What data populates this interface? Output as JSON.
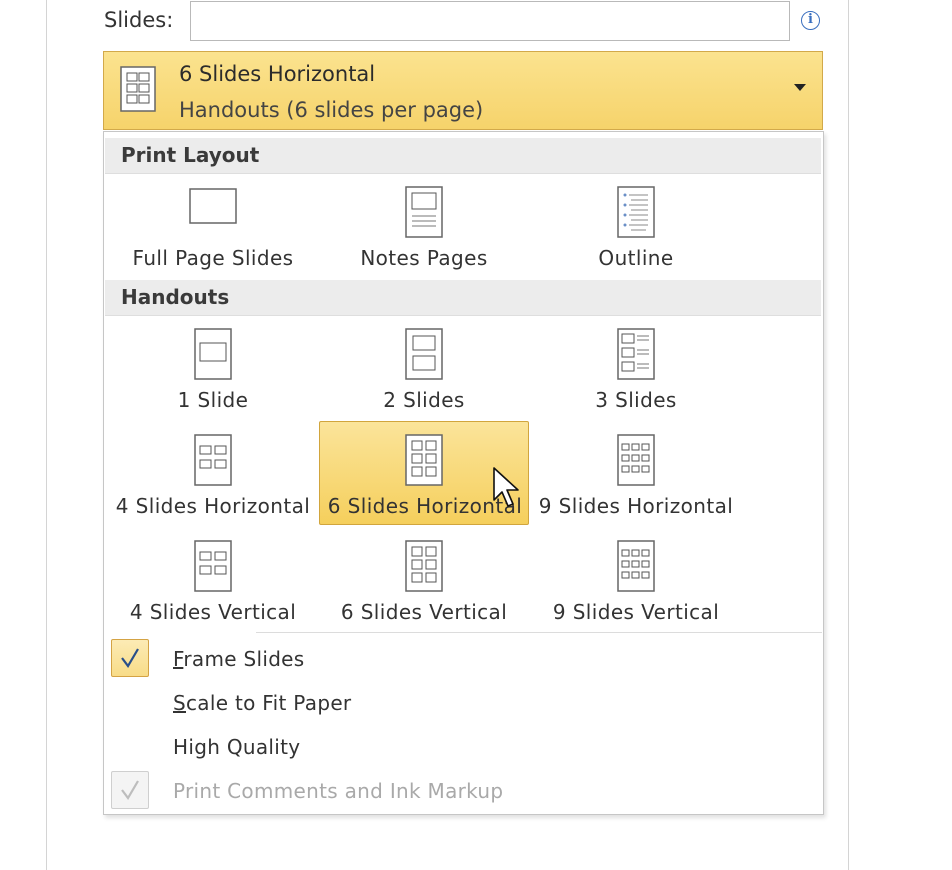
{
  "slides_label": "Slides:",
  "slides_input_value": "",
  "info_icon": "info-icon",
  "layout_dropdown": {
    "title": "6 Slides Horizontal",
    "subtitle": "Handouts (6 slides per page)"
  },
  "sections": {
    "print_layout": "Print Layout",
    "handouts": "Handouts"
  },
  "print_layout_items": [
    {
      "label": "Full Page Slides",
      "icon": "full-page-slides-icon"
    },
    {
      "label": "Notes Pages",
      "icon": "notes-pages-icon"
    },
    {
      "label": "Outline",
      "icon": "outline-icon"
    }
  ],
  "handout_items": [
    {
      "label": "1 Slide",
      "icon": "one-slide-icon"
    },
    {
      "label": "2 Slides",
      "icon": "two-slides-icon"
    },
    {
      "label": "3 Slides",
      "icon": "three-slides-icon"
    },
    {
      "label": "4 Slides Horizontal",
      "icon": "four-slides-horizontal-icon"
    },
    {
      "label": "6 Slides Horizontal",
      "icon": "six-slides-horizontal-icon",
      "selected": true
    },
    {
      "label": "9 Slides Horizontal",
      "icon": "nine-slides-horizontal-icon"
    },
    {
      "label": "4 Slides Vertical",
      "icon": "four-slides-vertical-icon"
    },
    {
      "label": "6 Slides Vertical",
      "icon": "six-slides-vertical-icon"
    },
    {
      "label": "9 Slides Vertical",
      "icon": "nine-slides-vertical-icon"
    }
  ],
  "options": {
    "frame_slides": {
      "first": "F",
      "rest": "rame Slides",
      "checked": true
    },
    "scale_to_fit": {
      "first": "S",
      "rest": "cale to Fit Paper",
      "checked": false
    },
    "high_quality": {
      "label": "High Quality",
      "checked": false
    },
    "print_comments": {
      "label": "Print Comments and Ink Markup",
      "checked": true,
      "disabled": true
    }
  },
  "colors": {
    "selection_fill": "#f5cf5c",
    "selection_border": "#d1a53d",
    "info_blue": "#3a6fbf"
  }
}
